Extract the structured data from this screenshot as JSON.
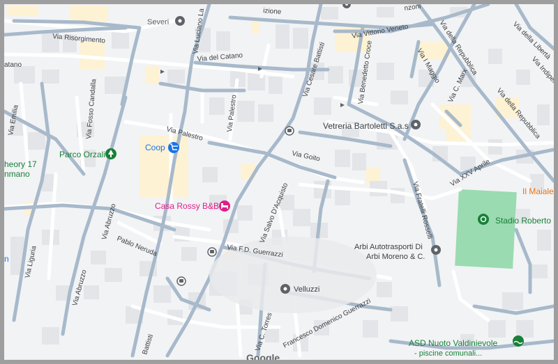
{
  "streets": [
    {
      "id": "risorgimento",
      "text": "Via Risorgimento"
    },
    {
      "id": "luciano",
      "text": "Via Luciano La"
    },
    {
      "id": "cesare-battisti",
      "text": "Via Cesare Battisti"
    },
    {
      "id": "vittorio-veneto",
      "text": "Via Vittorio Veneto"
    },
    {
      "id": "izione",
      "text": "izione"
    },
    {
      "id": "manzoni",
      "text": "nzoni"
    },
    {
      "id": "della-repubblica-1",
      "text": "Via della Repubblica"
    },
    {
      "id": "della-repubblica-2",
      "text": "Via della Repubblica"
    },
    {
      "id": "della-liberta",
      "text": "Via della Libertà"
    },
    {
      "id": "indipendenza",
      "text": "Via Indipen"
    },
    {
      "id": "maggio",
      "text": "Via I Maggio"
    },
    {
      "id": "marx",
      "text": "Via C. Marx"
    },
    {
      "id": "benedetto-croce",
      "text": "Via Benedetto Croce"
    },
    {
      "id": "catano-left",
      "text": "atano"
    },
    {
      "id": "del-catano",
      "text": "Via del Catano"
    },
    {
      "id": "emilia",
      "text": "Via Emilia"
    },
    {
      "id": "fosso-candalla",
      "text": "Via Fosso Candalla"
    },
    {
      "id": "palestro-1",
      "text": "Via Palestro"
    },
    {
      "id": "palestro-2",
      "text": "Via Palestro"
    },
    {
      "id": "goito",
      "text": "Via Goito"
    },
    {
      "id": "xxv-aprile",
      "text": "Via XXV Aprile"
    },
    {
      "id": "fratelli-rosselli",
      "text": "Via Fratelli Rosselli"
    },
    {
      "id": "abruzzo-1",
      "text": "Via Abruzzo"
    },
    {
      "id": "abruzzo-2",
      "text": "Via Abruzzo"
    },
    {
      "id": "salvo-dacquisto",
      "text": "Via Salvo D'Acquisto"
    },
    {
      "id": "pablo-neruda",
      "text": "Pablo Neruda"
    },
    {
      "id": "guerrazzi",
      "text": "Via F.D. Guerrazzi"
    },
    {
      "id": "liguria",
      "text": "Via Liguria"
    },
    {
      "id": "torres",
      "text": "Via C. Torres"
    },
    {
      "id": "francesco-guerrazzi",
      "text": "Francesco Domenico Guerrazzi"
    },
    {
      "id": "battisti-bottom",
      "text": "Battisti"
    }
  ],
  "places": [
    {
      "id": "severi",
      "name": "Severi"
    },
    {
      "id": "coop",
      "name": "Coop"
    },
    {
      "id": "parco-orzali",
      "name": "Parco Orzali"
    },
    {
      "id": "theory17",
      "line1": "heory 17",
      "line2": "nmano"
    },
    {
      "id": "casa-rossy",
      "name": "Casa Rossy B&B"
    },
    {
      "id": "vetreria",
      "name": "Vetreria Bartoletti S.a.s"
    },
    {
      "id": "arbi",
      "line1": "Arbi Autotrasporti Di",
      "line2": "Arbi Moreno & C."
    },
    {
      "id": "velluzzi",
      "name": "Velluzzi"
    },
    {
      "id": "stadio",
      "name": "Stadio Roberto S"
    },
    {
      "id": "maiale",
      "name": "Il Maiale"
    },
    {
      "id": "asd-nuoto",
      "line1": "ASD Nuoto Valdinievole",
      "line2": "- piscine comunali..."
    },
    {
      "id": "left-n",
      "name": "n"
    }
  ],
  "attribution": "Google",
  "icons": {
    "pin": "map-pin-icon",
    "shopping": "shopping-cart-icon",
    "park": "tree-icon",
    "hotel": "bed-icon",
    "transit": "bus-stop-icon",
    "swim": "swimmer-icon"
  },
  "colors": {
    "background": "#f2f3f5",
    "road": "#ffffff",
    "major_road": "#a7b9ca",
    "building": "#e3e5e8",
    "commercial": "#fdf2d4",
    "park": "#9adbb1",
    "label": "#3c4043",
    "poi_gray": "#5f6368",
    "shop_blue": "#1a73e8",
    "park_green": "#188038",
    "hotel_pink": "#e01e88",
    "orange": "#e8710a"
  }
}
